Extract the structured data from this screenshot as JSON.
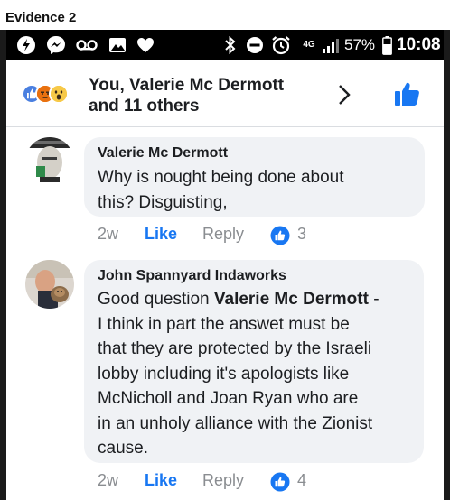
{
  "evidence_label": "Evidence 2",
  "status_bar": {
    "battery_percent": "57%",
    "time": "10:08",
    "network": "4G",
    "icons": [
      "bolt-app-icon",
      "messenger-icon",
      "voicemail-icon",
      "gallery-icon",
      "heart-icon",
      "bluetooth-icon",
      "do-not-disturb-icon",
      "alarm-icon",
      "network-4g-icon",
      "signal-icon",
      "battery-icon"
    ]
  },
  "reactions": {
    "summary_line1": "You, Valerie Mc Dermott",
    "summary_line2": "and 11 others",
    "types": [
      "like",
      "angry",
      "wow"
    ]
  },
  "comments": [
    {
      "author": "Valerie Mc Dermott",
      "lines": [
        "Why is nought being done about",
        "this? Disguisting,"
      ],
      "age": "2w",
      "like_label": "Like",
      "reply_label": "Reply",
      "like_count": "3"
    },
    {
      "author": "John Spannyard Indaworks",
      "first_line_prefix": "Good question ",
      "mention": "Valerie Mc Dermott",
      "first_line_suffix": " -",
      "lines": [
        "I think in part the answet must be",
        "that they are protected by the Israeli",
        "lobby including it's apologists like",
        "McNicholl and Joan Ryan who are",
        "in an unholy alliance with the Zionist",
        "cause."
      ],
      "age": "2w",
      "like_label": "Like",
      "reply_label": "Reply",
      "like_count": "4"
    }
  ],
  "colors": {
    "facebook_blue": "#1877f2",
    "bubble_bg": "#f0f2f5",
    "meta_gray": "#8a8d91"
  }
}
